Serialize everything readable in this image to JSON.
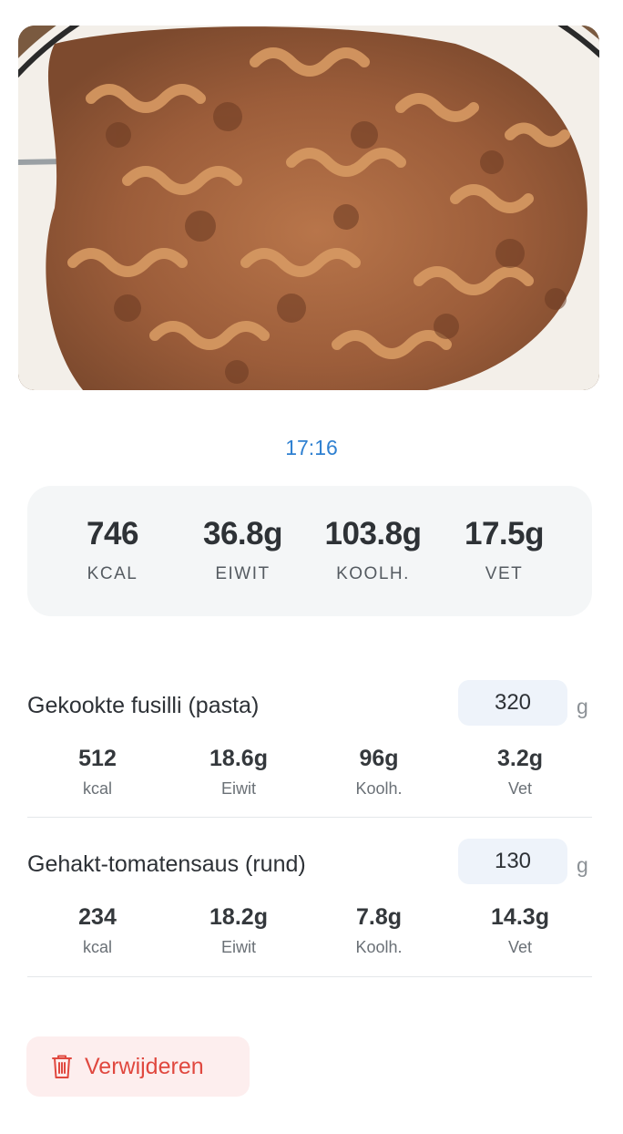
{
  "meal": {
    "photo_icon": "pasta-dish-photo",
    "time": "17:16"
  },
  "totals": [
    {
      "value": "746",
      "label": "KCAL"
    },
    {
      "value": "36.8g",
      "label": "EIWIT"
    },
    {
      "value": "103.8g",
      "label": "KOOLH."
    },
    {
      "value": "17.5g",
      "label": "VET"
    }
  ],
  "items": [
    {
      "name": "Gekookte fusilli (pasta)",
      "quantity": "320",
      "unit": "g",
      "nutrients": [
        {
          "value": "512",
          "label": "kcal"
        },
        {
          "value": "18.6g",
          "label": "Eiwit"
        },
        {
          "value": "96g",
          "label": "Koolh."
        },
        {
          "value": "3.2g",
          "label": "Vet"
        }
      ]
    },
    {
      "name": "Gehakt-tomatensaus (rund)",
      "quantity": "130",
      "unit": "g",
      "nutrients": [
        {
          "value": "234",
          "label": "kcal"
        },
        {
          "value": "18.2g",
          "label": "Eiwit"
        },
        {
          "value": "7.8g",
          "label": "Koolh."
        },
        {
          "value": "14.3g",
          "label": "Vet"
        }
      ]
    }
  ],
  "actions": {
    "delete_label": "Verwijderen",
    "delete_icon": "trash-icon"
  },
  "colors": {
    "accent": "#2f80d1",
    "danger": "#e0483f",
    "danger_bg": "#fdeeee",
    "card_bg": "#f4f6f7",
    "qty_bg": "#eef3fa"
  }
}
